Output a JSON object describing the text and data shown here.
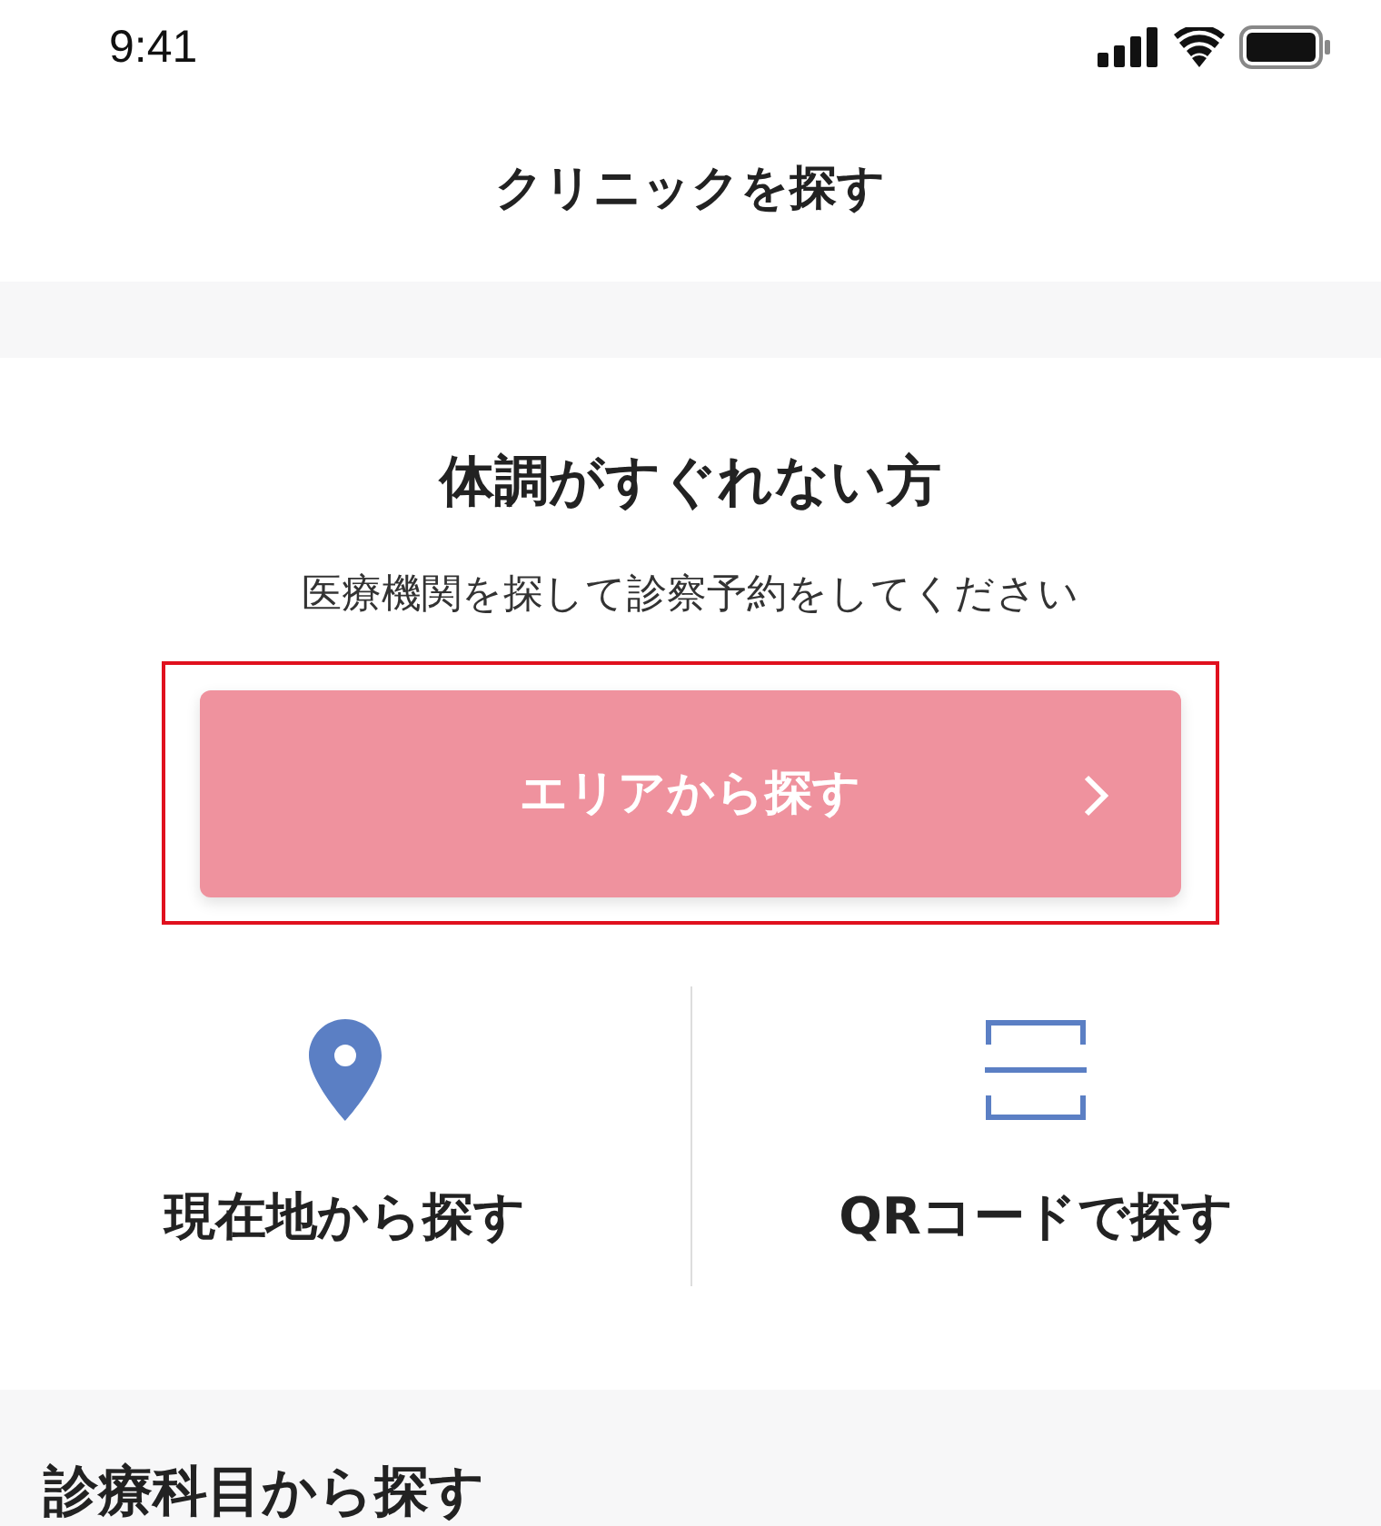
{
  "status_bar": {
    "time": "9:41"
  },
  "nav": {
    "title": "クリニックを探す"
  },
  "card": {
    "heading": "体調がすぐれない方",
    "subtitle": "医療機関を探して診察予約をしてください",
    "primary_button": {
      "label": "エリアから探す",
      "highlighted": true
    },
    "options": [
      {
        "kind": "location",
        "label": "現在地から探す"
      },
      {
        "kind": "qr",
        "label": "QRコードで探す"
      }
    ]
  },
  "section": {
    "title": "診療科目から探す"
  }
}
